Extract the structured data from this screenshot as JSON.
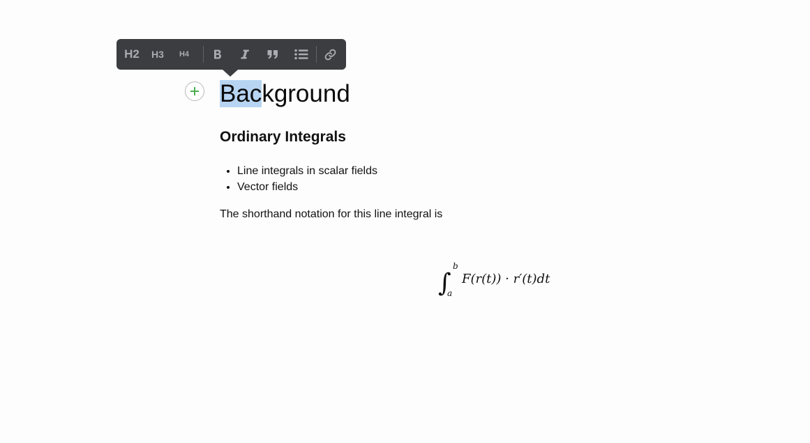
{
  "toolbar": {
    "h2_label": "H2",
    "h3_label": "H3",
    "h4_label": "H4",
    "bold_icon": "bold-icon",
    "italic_icon": "italic-icon",
    "quote_icon": "quote-icon",
    "list_icon": "bulleted-list-icon",
    "link_icon": "link-icon",
    "background_color": "#3b3d40",
    "icon_color": "#a9acb0"
  },
  "add_button": {
    "icon": "plus-icon",
    "color": "#4caf50"
  },
  "document": {
    "heading_selected": "Bac",
    "heading_rest": "kground",
    "subheading": "Ordinary Integrals",
    "bullets": [
      "Line integrals in scalar fields",
      "Vector fields"
    ],
    "paragraph": "The shorthand notation for this line integral is",
    "formula": {
      "integral_sign": "∫",
      "upper_limit": "b",
      "lower_limit": "a",
      "body": "F(r(t)) · r′(t)dt"
    },
    "selection_color": "#b7d5f2"
  }
}
